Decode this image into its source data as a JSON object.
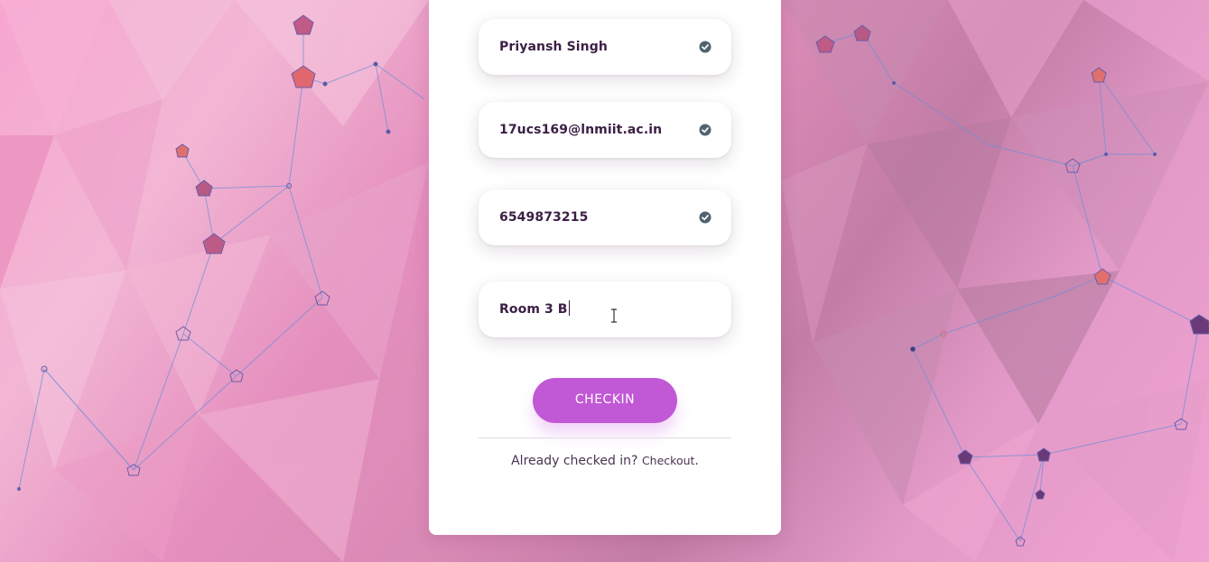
{
  "form": {
    "name": {
      "value": "Priyansh Singh",
      "verified": true,
      "icon": "check-circle-icon"
    },
    "email": {
      "value": "17ucs169@lnmiit.ac.in",
      "verified": true,
      "icon": "check-circle-icon"
    },
    "phone": {
      "value": "6549873215",
      "verified": true,
      "icon": "check-circle-icon"
    },
    "room": {
      "value": "Room 3 B"
    }
  },
  "checkin_button": {
    "label": "CHECKIN"
  },
  "footer": {
    "prompt": "Already checked in?",
    "link_label": "Checkout",
    "suffix": "."
  },
  "colors": {
    "accent": "#c158d6",
    "text": "#3b1f45",
    "check_icon": "#4f6470"
  }
}
